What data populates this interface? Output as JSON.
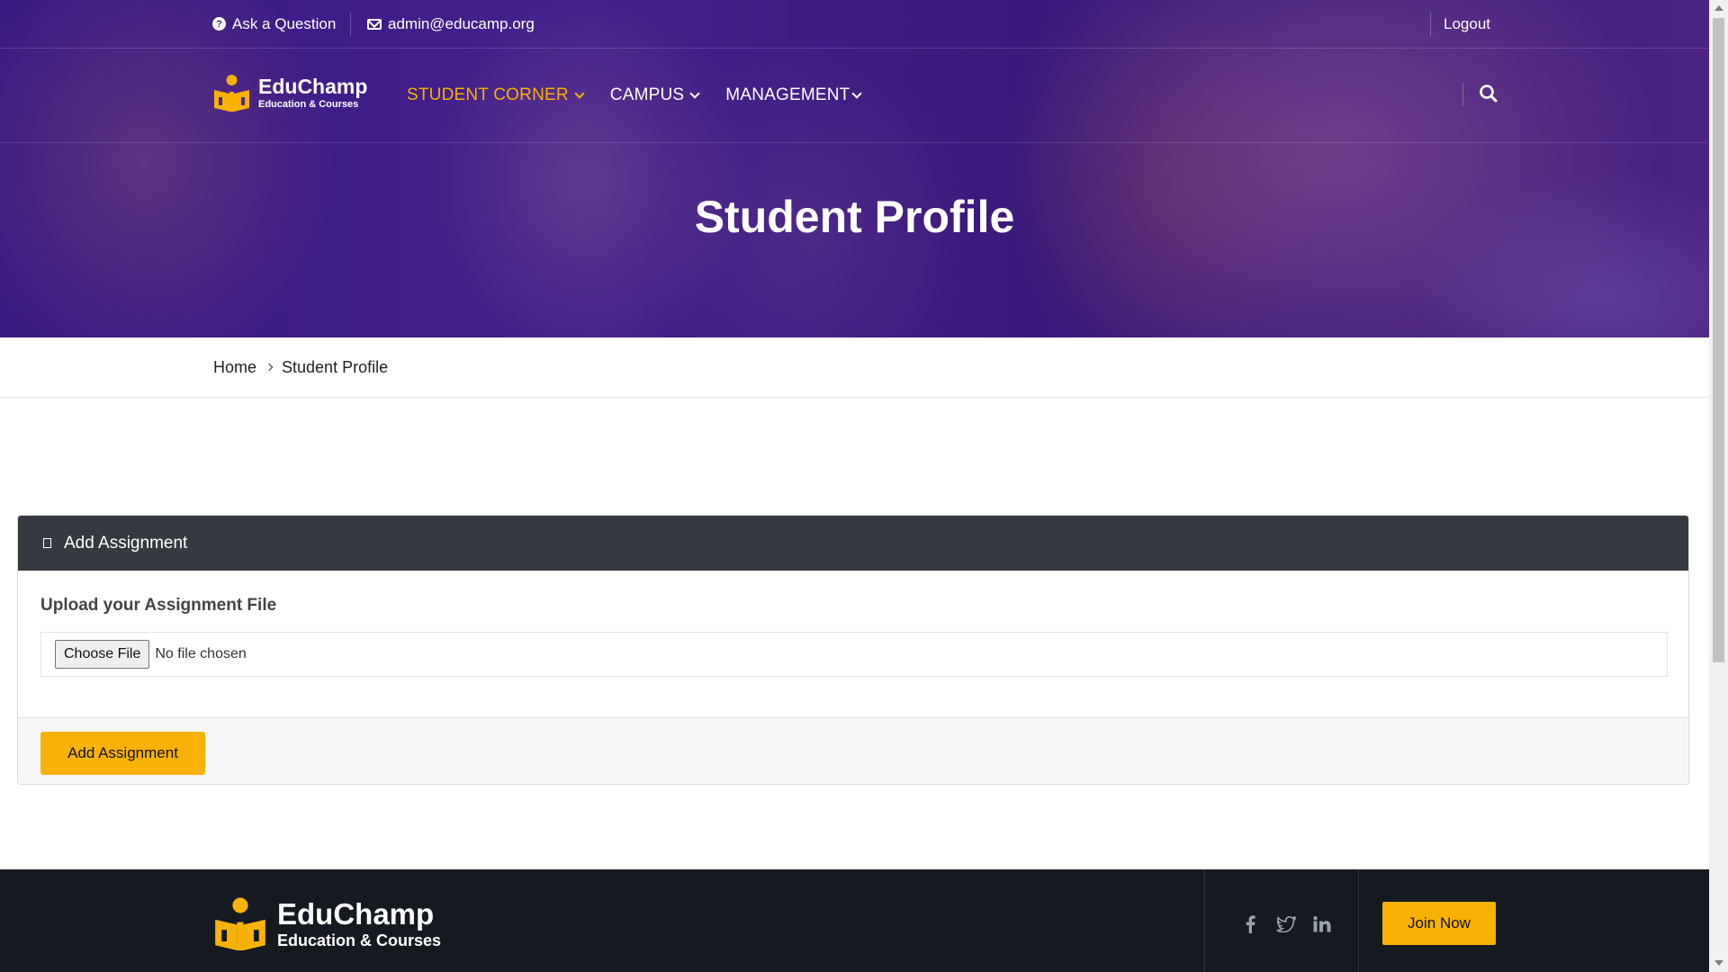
{
  "topbar": {
    "ask_label": "Ask a Question",
    "email": "admin@educamp.org",
    "logout_label": "Logout"
  },
  "brand": {
    "name": "EduChamp",
    "tagline": "Education & Courses"
  },
  "nav": {
    "items": [
      {
        "label": "STUDENT CORNER",
        "active": true
      },
      {
        "label": "CAMPUS",
        "active": false
      },
      {
        "label": "MANAGEMENT",
        "active": false
      }
    ]
  },
  "hero": {
    "title": "Student Profile"
  },
  "breadcrumb": {
    "home": "Home",
    "current": "Student Profile"
  },
  "assignment": {
    "header": "Add Assignment",
    "field_label": "Upload your Assignment File",
    "file_button": "Choose File",
    "file_status": "No file chosen",
    "submit_label": "Add Assignment"
  },
  "footer": {
    "brand_name": "EduChamp",
    "brand_tagline": "Education & Courses",
    "social": [
      "facebook-icon",
      "twitter-icon",
      "linkedin-icon"
    ],
    "join_label": "Join Now"
  },
  "colors": {
    "accent": "#f7b205",
    "card_header": "#343a40",
    "footer_bg": "#151a20"
  }
}
